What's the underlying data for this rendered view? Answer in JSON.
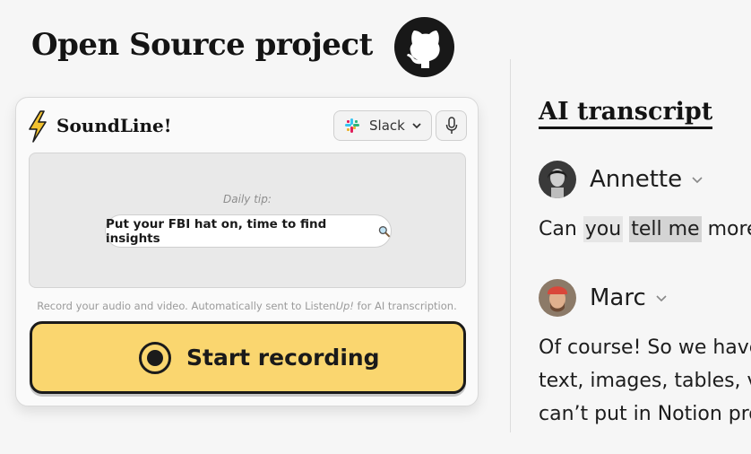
{
  "header": {
    "title": "Open Source project",
    "github_icon": "github-octocat-icon"
  },
  "widget": {
    "app_name": "SoundLine!",
    "logo_icon": "lightning-bolt-icon",
    "integration": {
      "selected": "Slack",
      "icon": "slack-icon"
    },
    "mic_icon": "microphone-icon",
    "tip": {
      "label": "Daily tip:",
      "text": "Put your FBI hat on, time to find insights",
      "emoji": "magnifying-glass-icon"
    },
    "note_before": "Record your audio and video. Automatically sent to Listen",
    "note_italic": "Up!",
    "note_after": " for AI transcription.",
    "record_button": "Start recording",
    "colors": {
      "button": "#fad66f",
      "bolt": "#f2c230"
    }
  },
  "transcript": {
    "title": "AI transcript",
    "entries": [
      {
        "speaker": "Annette",
        "parts": [
          "Can ",
          "you",
          " ",
          "tell me",
          " more"
        ]
      },
      {
        "speaker": "Marc",
        "lines": [
          "Of course! So we have",
          "text, images, tables, v",
          "can’t put in Notion pro"
        ]
      }
    ]
  }
}
